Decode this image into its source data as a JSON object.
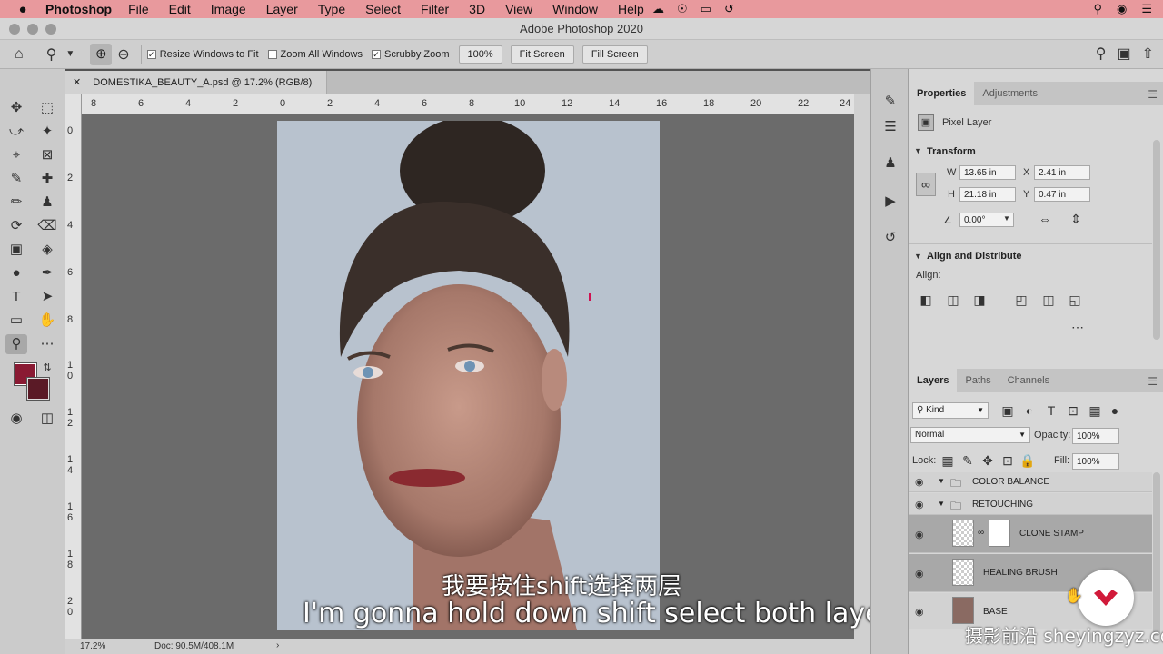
{
  "menubar": {
    "app": "Photoshop",
    "items": [
      "File",
      "Edit",
      "Image",
      "Layer",
      "Type",
      "Select",
      "Filter",
      "3D",
      "View",
      "Window",
      "Help"
    ]
  },
  "window": {
    "title": "Adobe Photoshop 2020"
  },
  "options": {
    "resize_windows": "Resize Windows to Fit",
    "zoom_all": "Zoom All Windows",
    "scrubby": "Scrubby Zoom",
    "zoom_value": "100%",
    "fit_screen": "Fit Screen",
    "fill_screen": "Fill Screen"
  },
  "document": {
    "tab": "DOMESTIKA_BEAUTY_A.psd @ 17.2% (RGB/8)",
    "ruler_top": [
      "8",
      "6",
      "4",
      "2",
      "0",
      "2",
      "4",
      "6",
      "8",
      "10",
      "12",
      "14",
      "16",
      "18",
      "20",
      "22",
      "24"
    ],
    "ruler_left": [
      "0",
      "2",
      "4",
      "6",
      "8",
      "1 0",
      "1 2",
      "1 4",
      "1 6",
      "1 8",
      "2 0"
    ],
    "status_zoom": "17.2%",
    "status_doc": "Doc: 90.5M/408.1M"
  },
  "subtitles": {
    "cn": "我要按住shift选择两层",
    "en": "I'm gonna hold down shift select both layer"
  },
  "properties": {
    "tabs": [
      "Properties",
      "Adjustments"
    ],
    "layer_type": "Pixel Layer",
    "transform_title": "Transform",
    "w_label": "W",
    "w_value": "13.65 in",
    "h_label": "H",
    "h_value": "21.18 in",
    "x_label": "X",
    "x_value": "2.41 in",
    "y_label": "Y",
    "y_value": "0.47 in",
    "angle_value": "0.00°",
    "align_title": "Align and Distribute",
    "align_label": "Align:"
  },
  "layers": {
    "tabs": [
      "Layers",
      "Paths",
      "Channels"
    ],
    "kind": "Kind",
    "blend_mode": "Normal",
    "opacity_label": "Opacity:",
    "opacity_value": "100%",
    "lock_label": "Lock:",
    "fill_label": "Fill:",
    "fill_value": "100%",
    "items": [
      {
        "name": "COLOR BALANCE"
      },
      {
        "name": "RETOUCHING"
      },
      {
        "name": "CLONE STAMP"
      },
      {
        "name": "HEALING BRUSH"
      },
      {
        "name": "BASE"
      }
    ]
  },
  "watermark": "摄影前沿 sheyingzyz.com",
  "colors": {
    "foreground": "#8a1a33",
    "background": "#5a1a26",
    "menubar": "#e8999d"
  }
}
